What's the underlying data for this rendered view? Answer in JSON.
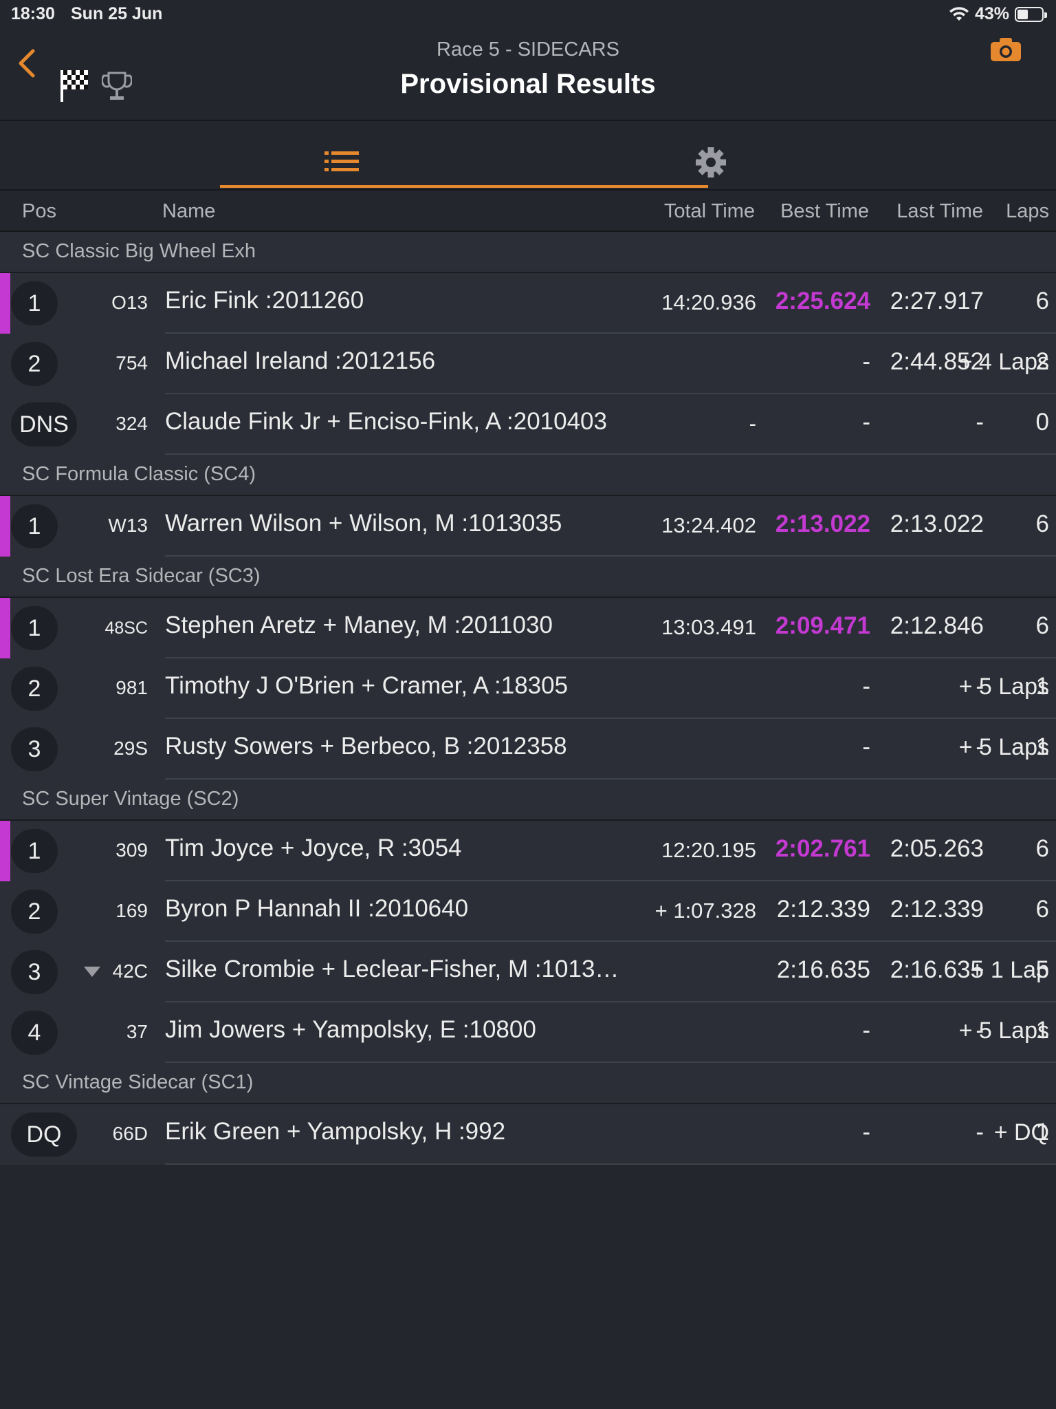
{
  "status": {
    "time": "18:30",
    "date": "Sun 25 Jun",
    "battery": "43%",
    "battery_level": 0.43
  },
  "header": {
    "subtitle": "Race 5 - SIDECARS",
    "title": "Provisional Results"
  },
  "columns": {
    "pos": "Pos",
    "name": "Name",
    "total": "Total Time",
    "best": "Best Time",
    "last": "Last Time",
    "laps": "Laps"
  },
  "colors": {
    "accent": "#e6892e",
    "fastest": "#c339d1",
    "background": "#23262d"
  },
  "groups": [
    {
      "name": "SC Classic Big Wheel Exh",
      "rows": [
        {
          "pos": "1",
          "num": "O13",
          "name": "Eric Fink :2011260",
          "total": "14:20.936",
          "best": "2:25.624",
          "last": "2:27.917",
          "laps": "6",
          "leader": true
        },
        {
          "pos": "2",
          "num": "754",
          "name": "Michael Ireland :2012156",
          "total": "+ 4 Laps",
          "best": "-",
          "last": "2:44.852",
          "laps": "2"
        },
        {
          "pos": "DNS",
          "num": "324",
          "name": "Claude Fink Jr + Enciso-Fink, A :2010403",
          "total": "-",
          "best": "-",
          "last": "-",
          "laps": "0"
        }
      ]
    },
    {
      "name": "SC Formula Classic (SC4)",
      "rows": [
        {
          "pos": "1",
          "num": "W13",
          "name": "Warren Wilson + Wilson, M :1013035",
          "total": "13:24.402",
          "best": "2:13.022",
          "last": "2:13.022",
          "laps": "6",
          "leader": true
        }
      ]
    },
    {
      "name": "SC Lost Era Sidecar (SC3)",
      "rows": [
        {
          "pos": "1",
          "num": "48SC",
          "name": "Stephen Aretz + Maney, M :2011030",
          "total": "13:03.491",
          "best": "2:09.471",
          "last": "2:12.846",
          "laps": "6",
          "leader": true
        },
        {
          "pos": "2",
          "num": "981",
          "name": "Timothy J O'Brien + Cramer, A :18305",
          "total": "+ 5 Laps",
          "best": "-",
          "last": "-",
          "laps": "1"
        },
        {
          "pos": "3",
          "num": "29S",
          "name": "Rusty Sowers + Berbeco, B :2012358",
          "total": "+ 5 Laps",
          "best": "-",
          "last": "-",
          "laps": "1"
        }
      ]
    },
    {
      "name": "SC Super Vintage (SC2)",
      "rows": [
        {
          "pos": "1",
          "num": "309",
          "name": "Tim Joyce + Joyce, R :3054",
          "total": "12:20.195",
          "best": "2:02.761",
          "last": "2:05.263",
          "laps": "6",
          "leader": true
        },
        {
          "pos": "2",
          "num": "169",
          "name": "Byron P Hannah II :2010640",
          "total": "+ 1:07.328",
          "best": "2:12.339",
          "last": "2:12.339",
          "laps": "6"
        },
        {
          "pos": "3",
          "num": "42C",
          "name": "Silke Crombie + Leclear-Fisher, M :1013…",
          "total": "+ 1 Lap",
          "best": "2:16.635",
          "last": "2:16.635",
          "laps": "5",
          "arrow": true
        },
        {
          "pos": "4",
          "num": "37",
          "name": "Jim Jowers + Yampolsky, E :10800",
          "total": "+ 5 Laps",
          "best": "-",
          "last": "-",
          "laps": "1"
        }
      ]
    },
    {
      "name": "SC Vintage Sidecar (SC1)",
      "rows": [
        {
          "pos": "DQ",
          "num": "66D",
          "name": "Erik Green + Yampolsky, H :992",
          "total": "+ DQ",
          "best": "-",
          "last": "-",
          "laps": "1"
        }
      ]
    }
  ]
}
